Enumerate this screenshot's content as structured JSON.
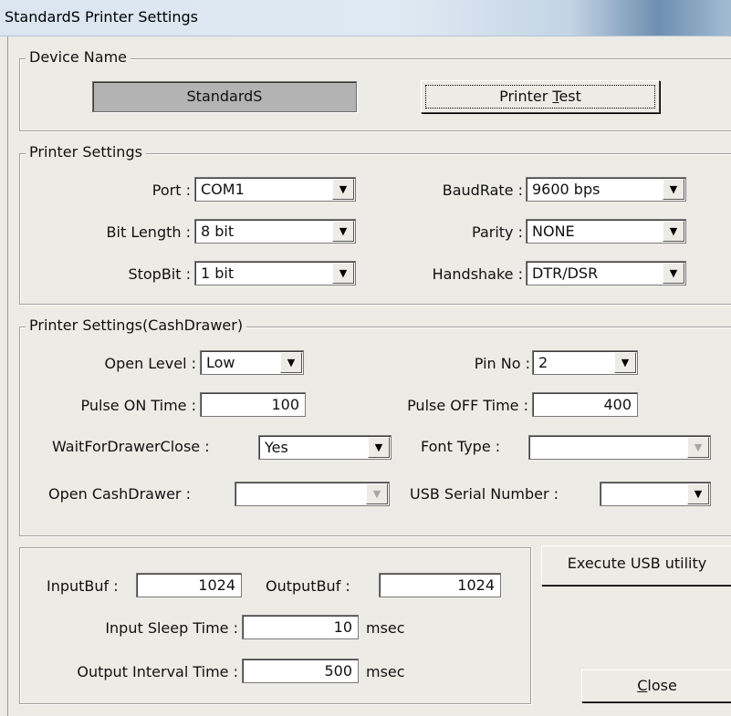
{
  "window": {
    "title": "StandardS Printer Settings"
  },
  "device": {
    "legend": "Device Name",
    "name": "StandardS",
    "test_button_pre": "Printer ",
    "test_button_ul": "T",
    "test_button_post": "est"
  },
  "printer": {
    "legend": "Printer Settings",
    "port_label": "Port :",
    "port_value": "COM1",
    "bitlength_label": "Bit Length :",
    "bitlength_value": "8 bit",
    "stopbit_label": "StopBit :",
    "stopbit_value": "1 bit",
    "baudrate_label": "BaudRate :",
    "baudrate_value": "9600 bps",
    "parity_label": "Parity :",
    "parity_value": "NONE",
    "handshake_label": "Handshake :",
    "handshake_value": "DTR/DSR"
  },
  "drawer": {
    "legend": "Printer Settings(CashDrawer)",
    "open_level_label": "Open Level :",
    "open_level_value": "Low",
    "pin_no_label": "Pin No :",
    "pin_no_value": "2",
    "pulse_on_label": "Pulse ON Time :",
    "pulse_on_value": "100",
    "pulse_off_label": "Pulse OFF Time :",
    "pulse_off_value": "400",
    "wait_label": "WaitForDrawerClose :",
    "wait_value": "Yes",
    "font_type_label": "Font Type :",
    "font_type_value": "",
    "open_cashdrawer_label": "Open CashDrawer :",
    "open_cashdrawer_value": "",
    "usb_serial_label": "USB Serial Number :",
    "usb_serial_value": ""
  },
  "buffer": {
    "input_buf_label": "InputBuf :",
    "input_buf_value": "1024",
    "output_buf_label": "OutputBuf :",
    "output_buf_value": "1024",
    "input_sleep_label": "Input Sleep Time :",
    "input_sleep_value": "10",
    "input_sleep_unit": "msec",
    "output_interval_label": "Output Interval Time :",
    "output_interval_value": "500",
    "output_interval_unit": "msec"
  },
  "actions": {
    "usb_utility_label": "Execute USB utility",
    "close_ul": "C",
    "close_rest": "lose"
  },
  "icons": {
    "dropdown": "chevron-down-icon",
    "dropdown_glyph": "▼"
  }
}
